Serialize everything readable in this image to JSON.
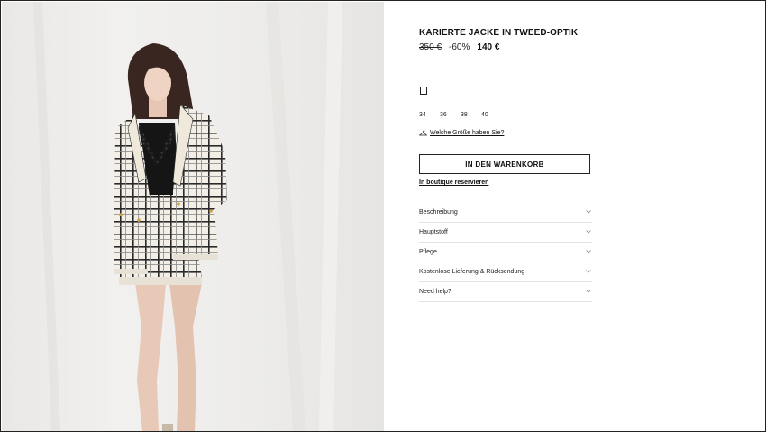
{
  "product": {
    "title": "KARIERTE JACKE IN TWEED-OPTIK",
    "old_price": "350 €",
    "discount": "-60%",
    "new_price": "140 €"
  },
  "sizes": [
    "34",
    "36",
    "38",
    "40"
  ],
  "size_guide_label": "Welche Größe haben Sie?",
  "add_to_cart_label": "IN DEN WARENKORB",
  "reserve_label": "In boutique reservieren",
  "accordion": [
    {
      "label": "Beschreibung",
      "icon": "chevron-down-icon"
    },
    {
      "label": "Hauptstoff",
      "icon": "chevron-down-icon"
    },
    {
      "label": "Pflege",
      "icon": "chevron-down-icon"
    },
    {
      "label": "Kostenlose Lieferung & Rücksendung",
      "icon": "chevron-down-icon"
    },
    {
      "label": "Need help?",
      "icon": "chevron-down-icon"
    }
  ],
  "colors": {
    "text": "#111111",
    "photo_background": "#eeedeb",
    "divider": "#e3e3e3"
  },
  "icons": {
    "size_guide": "hanger-icon",
    "color_swatch": "color-swatch-icon"
  }
}
